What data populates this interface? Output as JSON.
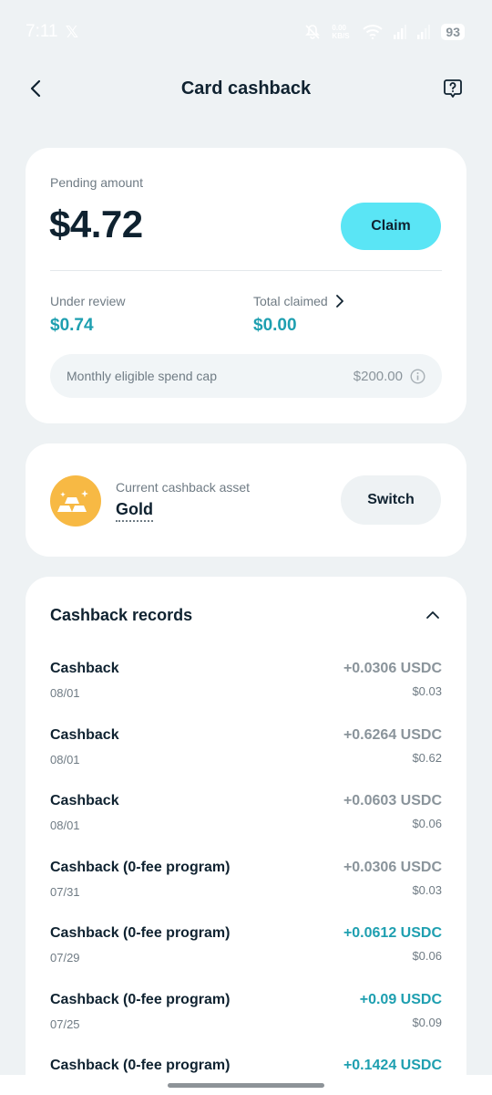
{
  "status_bar": {
    "time": "7:11",
    "x_logo": "𝕏",
    "net_speed": "0.00 KB/S",
    "battery": "93"
  },
  "header": {
    "title": "Card cashback"
  },
  "pending": {
    "label": "Pending amount",
    "amount": "$4.72",
    "claim_label": "Claim",
    "under_review_label": "Under review",
    "under_review_value": "$0.74",
    "total_claimed_label": "Total claimed",
    "total_claimed_value": "$0.00",
    "cap_label": "Monthly eligible spend cap",
    "cap_value": "$200.00"
  },
  "asset": {
    "label": "Current cashback asset",
    "value": "Gold",
    "switch_label": "Switch"
  },
  "records": {
    "title": "Cashback records",
    "items": [
      {
        "title": "Cashback",
        "date": "08/01",
        "amount": "+0.0306 USDC",
        "fiat": "$0.03",
        "status": "muted"
      },
      {
        "title": "Cashback",
        "date": "08/01",
        "amount": "+0.6264 USDC",
        "fiat": "$0.62",
        "status": "muted"
      },
      {
        "title": "Cashback",
        "date": "08/01",
        "amount": "+0.0603 USDC",
        "fiat": "$0.06",
        "status": "muted"
      },
      {
        "title": "Cashback (0-fee program)",
        "date": "07/31",
        "amount": "+0.0306 USDC",
        "fiat": "$0.03",
        "status": "muted"
      },
      {
        "title": "Cashback (0-fee program)",
        "date": "07/29",
        "amount": "+0.0612 USDC",
        "fiat": "$0.06",
        "status": "teal"
      },
      {
        "title": "Cashback (0-fee program)",
        "date": "07/25",
        "amount": "+0.09 USDC",
        "fiat": "$0.09",
        "status": "teal"
      },
      {
        "title": "Cashback (0-fee program)",
        "date": "",
        "amount": "+0.1424 USDC",
        "fiat": "",
        "status": "teal"
      }
    ]
  },
  "colors": {
    "accent": "#5ae5f5",
    "teal_text": "#1e9fb0",
    "gold": "#f7b944",
    "background": "#eef2f4"
  }
}
